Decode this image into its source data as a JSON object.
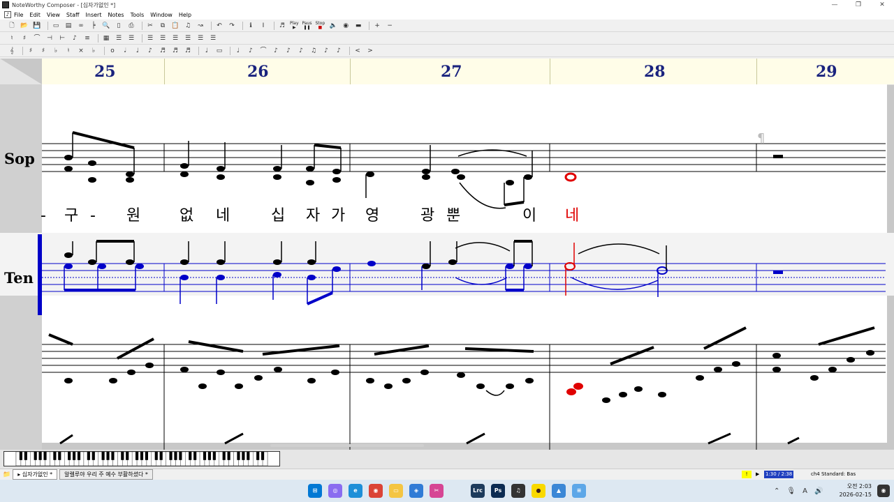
{
  "window": {
    "title": "NoteWorthy Composer - [십자가없인 *]",
    "controls": [
      "—",
      "❐",
      "✕"
    ]
  },
  "menu": {
    "items": [
      "File",
      "Edit",
      "View",
      "Staff",
      "Insert",
      "Notes",
      "Tools",
      "Window",
      "Help"
    ]
  },
  "toolbar": {
    "play_label": "Play",
    "pause_label": "Paus",
    "stop_label": "Stop"
  },
  "score": {
    "bar_numbers": [
      "25",
      "26",
      "27",
      "28",
      "29"
    ],
    "staff_labels": {
      "soprano": "Sop",
      "tenor": "Ten"
    },
    "lyrics": [
      {
        "text": "-",
        "color": "#000000"
      },
      {
        "text": "구",
        "color": "#000000"
      },
      {
        "text": "-",
        "color": "#000000"
      },
      {
        "text": "원",
        "color": "#000000"
      },
      {
        "text": "없",
        "color": "#000000"
      },
      {
        "text": "네",
        "color": "#000000"
      },
      {
        "text": "십",
        "color": "#000000"
      },
      {
        "text": "자",
        "color": "#000000"
      },
      {
        "text": "가",
        "color": "#000000"
      },
      {
        "text": "영",
        "color": "#000000"
      },
      {
        "text": "광",
        "color": "#000000"
      },
      {
        "text": "뿐",
        "color": "#000000"
      },
      {
        "text": "이",
        "color": "#000000"
      },
      {
        "text": "네",
        "color": "#e00000"
      }
    ],
    "colors": {
      "active_staff": "#0000c8",
      "cursor_note": "#e00000",
      "bar_number": "#1a237e"
    }
  },
  "statusbar": {
    "tabs": [
      "십자가없인 *",
      "알렐루야 우리 주 예수 부활하셨다 *"
    ],
    "position": "1:30 / 2:38",
    "staff_info": "ch4 Standard: Bas"
  },
  "taskbar": {
    "time": "오전 2:03",
    "date": "2026-02-15",
    "apps": [
      "start",
      "copilot",
      "edge",
      "chrome",
      "explorer",
      "browser",
      "snip",
      "lrc",
      "ps",
      "noteworthy",
      "kakaotalk",
      "photos",
      "notepad"
    ]
  }
}
